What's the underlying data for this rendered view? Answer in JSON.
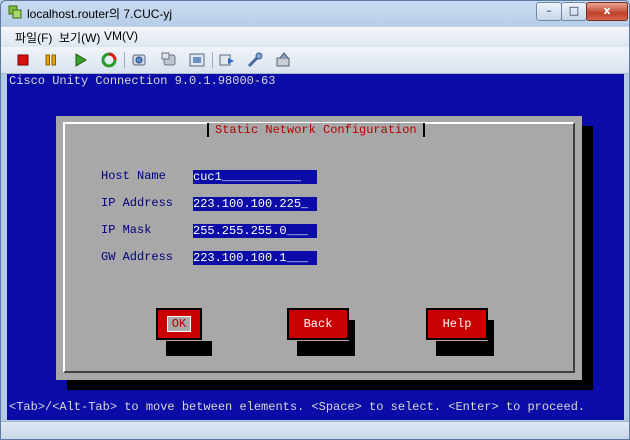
{
  "window": {
    "title": "localhost.router의 7.CUC-yj",
    "controls": {
      "minimize": "–",
      "maximize": "□",
      "close": "x"
    }
  },
  "menubar": {
    "items": [
      {
        "label": "파일(F)"
      },
      {
        "label": "보기(W)"
      },
      {
        "label": "VM(V)"
      }
    ]
  },
  "toolbar": {
    "icons": [
      "stop-icon",
      "pause-icon",
      "play-icon",
      "reset-icon",
      "snapshot-icon",
      "revert-snapshot-icon",
      "snapshot-manager-icon",
      "send-icon",
      "connect-icon",
      "settings-icon"
    ]
  },
  "console": {
    "header": "Cisco Unity Connection 9.0.1.98000-63",
    "dialog": {
      "title": "Static Network Configuration",
      "fields": [
        {
          "label": "Host Name",
          "value": "cuc1___________"
        },
        {
          "label": "IP Address",
          "value": "223.100.100.225_"
        },
        {
          "label": "IP Mask",
          "value": "255.255.255.0___"
        },
        {
          "label": "GW Address",
          "value": "223.100.100.1___"
        }
      ],
      "buttons": {
        "ok": "OK",
        "back": "Back",
        "help": "Help"
      }
    },
    "hint": "<Tab>/<Alt-Tab> to move between elements. <Space> to select. <Enter> to proceed."
  },
  "colors": {
    "console_bg": "#0b0ba8",
    "dialog_bg": "#a8a8a8",
    "title_red": "#b30000",
    "button_red": "#c80000",
    "label_blue": "#00007a"
  }
}
